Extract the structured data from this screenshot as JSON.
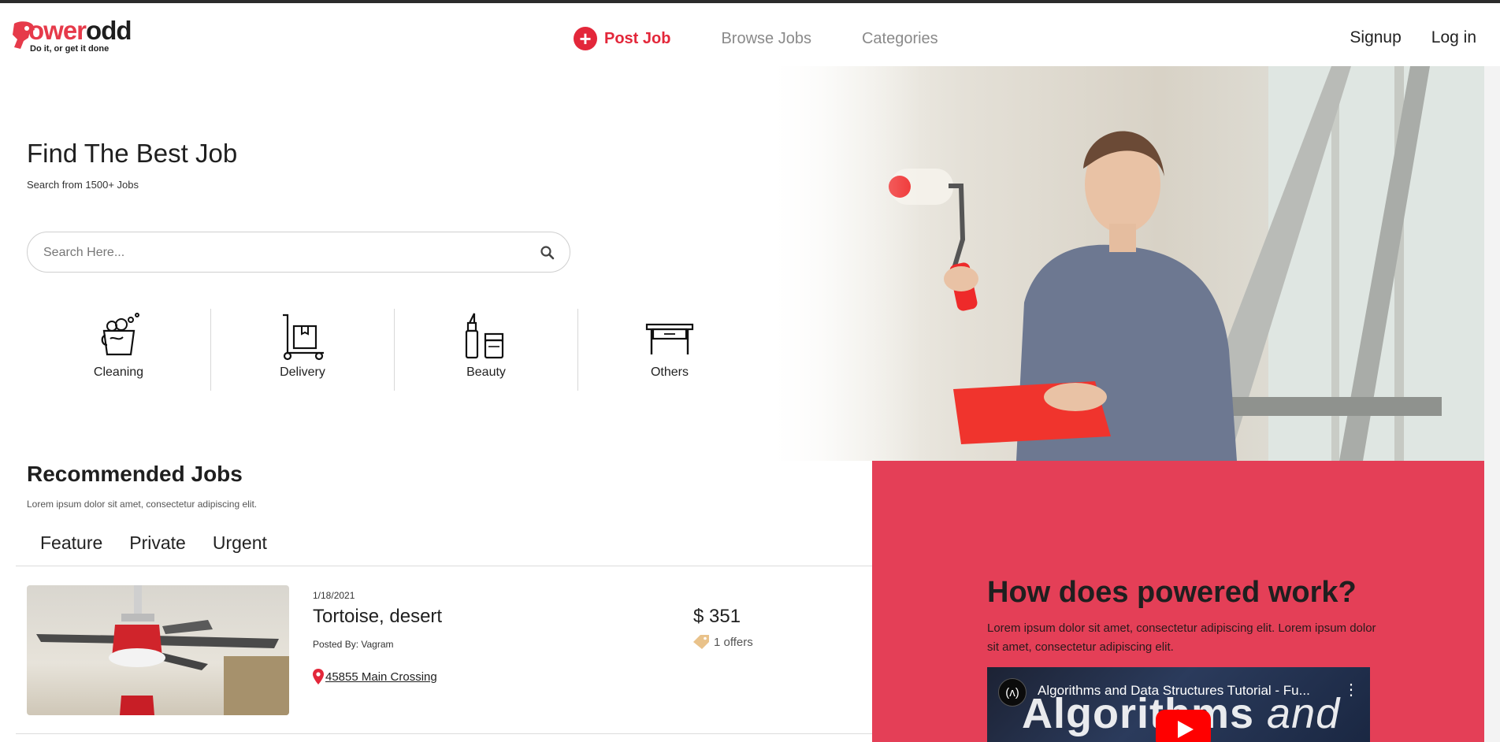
{
  "header": {
    "logo_word_brand": "ower",
    "logo_word_odd": "odd",
    "logo_tagline": "Do it, or get it done",
    "post_job": "Post Job",
    "browse_jobs": "Browse Jobs",
    "categories": "Categories",
    "signup": "Signup",
    "login": "Log in"
  },
  "hero": {
    "title": "Find The Best Job",
    "subtitle": "Search from 1500+ Jobs",
    "search_placeholder": "Search Here..."
  },
  "categories": [
    {
      "label": "Cleaning",
      "icon": "cleaning-bucket-icon"
    },
    {
      "label": "Delivery",
      "icon": "delivery-trolley-icon"
    },
    {
      "label": "Beauty",
      "icon": "beauty-lipstick-icon"
    },
    {
      "label": "Others",
      "icon": "table-icon"
    }
  ],
  "recommended": {
    "title": "Recommended Jobs",
    "subtitle": "Lorem ipsum dolor sit amet, consectetur adipiscing elit.",
    "tabs": [
      "Feature",
      "Private",
      "Urgent"
    ]
  },
  "jobs": [
    {
      "date": "1/18/2021",
      "title": "Tortoise, desert",
      "posted_by": "Posted By: Vagram",
      "address": "45855 Main Crossing",
      "price": "$ 351",
      "offers": "1 offers"
    }
  ],
  "how": {
    "title": "How does powered work?",
    "text": "Lorem ipsum dolor sit amet, consectetur adipiscing elit. Lorem ipsum dolor sit amet, consectetur adipiscing elit.",
    "video_title": "Algorithms and Data Structures Tutorial - Fu...",
    "video_overlay": "Algorithms",
    "video_overlay_italic": "and"
  },
  "colors": {
    "brand_red": "#e3273a",
    "how_bg": "#e43f57"
  }
}
